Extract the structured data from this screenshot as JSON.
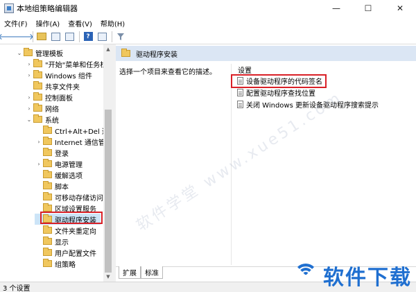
{
  "window": {
    "title": "本地组策略编辑器",
    "controls": {
      "minimize": "—",
      "maximize": "☐",
      "close": "✕"
    }
  },
  "menu": [
    "文件(F)",
    "操作(A)",
    "查看(V)",
    "帮助(H)"
  ],
  "toolbar": {
    "back": "🡐",
    "forward": "🡒"
  },
  "tree": {
    "items": [
      {
        "label": "管理模板",
        "arrow": "⌄"
      },
      {
        "label": "\"开始\"菜单和任务栏",
        "arrow": "›"
      },
      {
        "label": "Windows 组件",
        "arrow": "›"
      },
      {
        "label": "共享文件夹",
        "arrow": ""
      },
      {
        "label": "控制面板",
        "arrow": "›"
      },
      {
        "label": "网络",
        "arrow": "›"
      },
      {
        "label": "系统",
        "arrow": "⌄"
      },
      {
        "label": "Ctrl+Alt+Del 选",
        "arrow": ""
      },
      {
        "label": "Internet 通信管",
        "arrow": "›"
      },
      {
        "label": "登录",
        "arrow": ""
      },
      {
        "label": "电源管理",
        "arrow": "›"
      },
      {
        "label": "缓解选项",
        "arrow": ""
      },
      {
        "label": "脚本",
        "arrow": ""
      },
      {
        "label": "可移动存储访问",
        "arrow": ""
      },
      {
        "label": "区域设置服务",
        "arrow": ""
      },
      {
        "label": "驱动程序安装",
        "arrow": ""
      },
      {
        "label": "文件夹重定向",
        "arrow": ""
      },
      {
        "label": "显示",
        "arrow": ""
      },
      {
        "label": "用户配置文件",
        "arrow": ""
      },
      {
        "label": "组策略",
        "arrow": ""
      }
    ]
  },
  "main": {
    "header": "驱动程序安装",
    "description": "选择一个项目来查看它的描述。",
    "settings_title": "设置",
    "settings": [
      "设备驱动程序的代码签名",
      "配置驱动程序查找位置",
      "关闭 Windows 更新设备驱动程序搜索提示"
    ]
  },
  "tabs": [
    "扩展",
    "标准"
  ],
  "status": "3 个设置",
  "watermark": {
    "brand": "软件下载",
    "diagonal": "软件学堂 www.xue51.com"
  }
}
